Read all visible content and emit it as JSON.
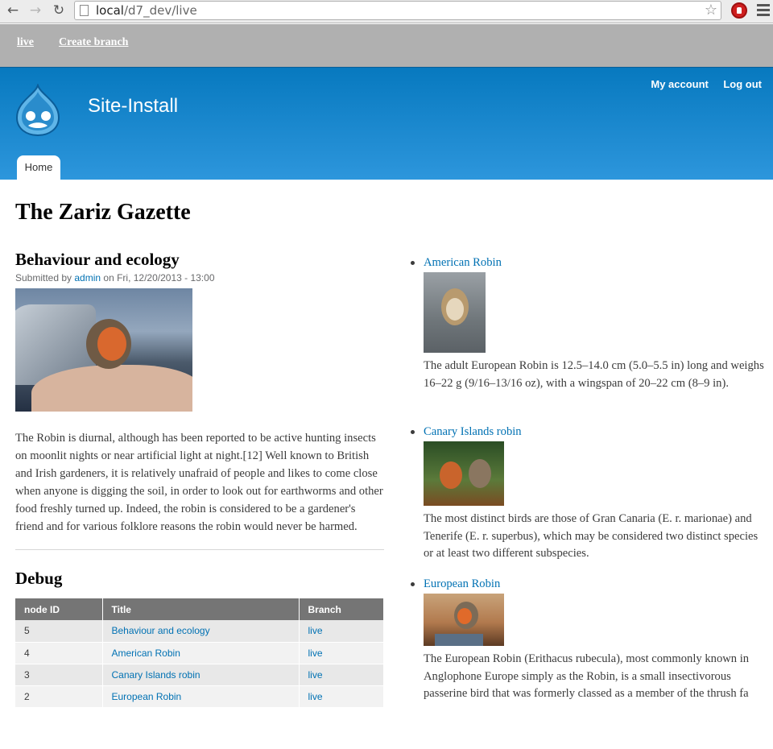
{
  "browser": {
    "url_host": "local",
    "url_path": "/d7_dev/live"
  },
  "toolbar": {
    "live": "live",
    "create_branch": "Create branch"
  },
  "header": {
    "site_name": "Site-Install",
    "my_account": "My account",
    "logout": "Log out",
    "tab_home": "Home"
  },
  "page": {
    "title": "The Zariz Gazette"
  },
  "node": {
    "title": "Behaviour and ecology",
    "submitted_prefix": "Submitted by ",
    "author": "admin",
    "submitted_suffix": " on Fri, 12/20/2013 - 13:00",
    "body": "The Robin is diurnal, although has been reported to be active hunting insects on moonlit nights or near artificial light at night.[12] Well known to British and Irish gardeners, it is relatively unafraid of people and likes to come close when anyone is digging the soil, in order to look out for earthworms and other food freshly turned up. Indeed, the robin is considered to be a gardener's friend and for various folklore reasons the robin would never be harmed."
  },
  "debug": {
    "title": "Debug",
    "headers": [
      "node ID",
      "Title",
      "Branch"
    ],
    "rows": [
      {
        "id": "5",
        "title": "Behaviour and ecology",
        "branch": "live"
      },
      {
        "id": "4",
        "title": "American Robin",
        "branch": "live"
      },
      {
        "id": "3",
        "title": "Canary Islands robin",
        "branch": "live"
      },
      {
        "id": "2",
        "title": "European Robin",
        "branch": "live"
      }
    ]
  },
  "sidebar": {
    "items": [
      {
        "title": "American Robin",
        "text": "The adult European Robin is 12.5–14.0 cm (5.0–5.5 in) long and weighs 16–22 g (9/16–13/16 oz), with a wingspan of 20–22 cm (8–9 in)."
      },
      {
        "title": "Canary Islands robin",
        "text": "The most distinct birds are those of Gran Canaria (E. r. marionae) and Tenerife (E. r. superbus), which may be considered two distinct species or at least two different subspecies."
      },
      {
        "title": "European Robin",
        "text": "The European Robin (Erithacus rubecula), most commonly known in Anglophone Europe simply as the Robin, is a small insectivorous passerine bird that was formerly classed as a member of the thrush fa"
      }
    ]
  }
}
